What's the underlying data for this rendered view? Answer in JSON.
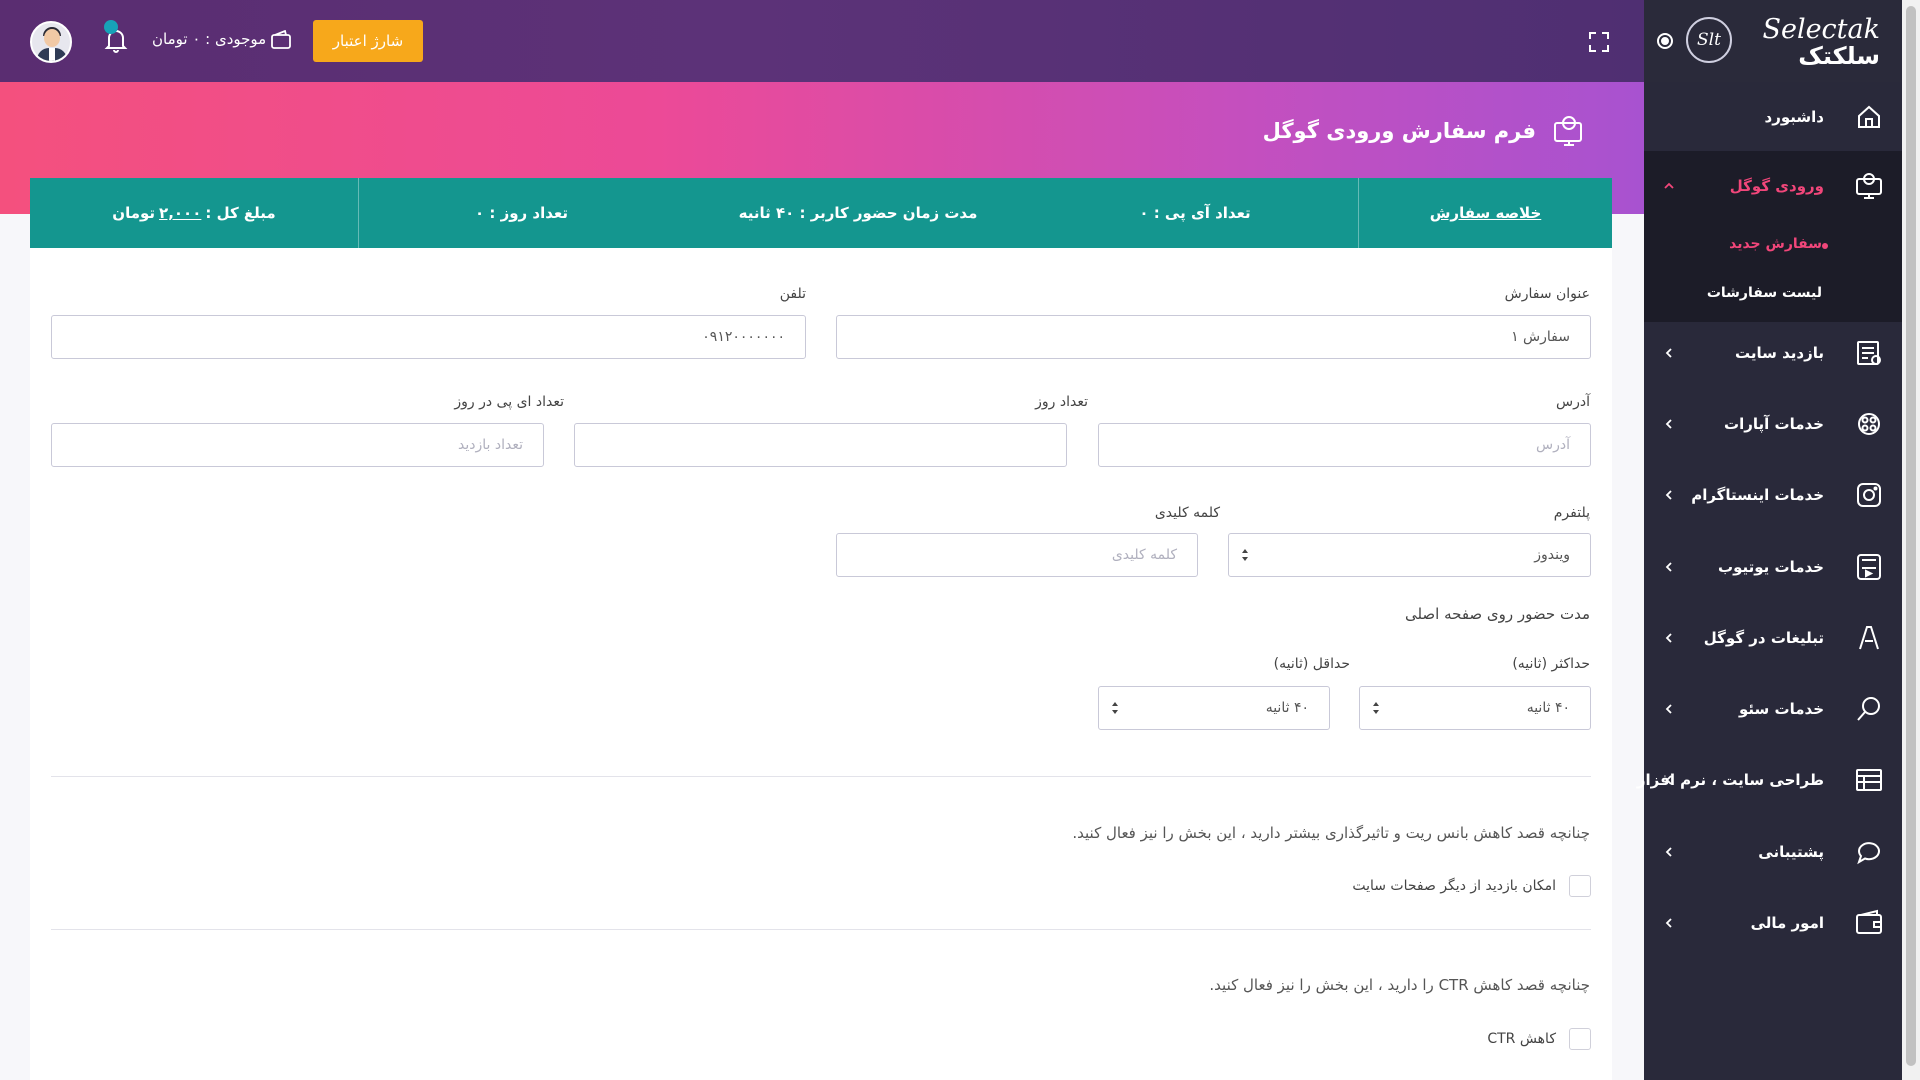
{
  "topbar": {
    "balance_text": "موجودی : ۰ تومان",
    "charge_button": "شارژ اعتبار"
  },
  "banner": {
    "title": "فرم سفارش ورودی گوگل"
  },
  "summary": {
    "order_summary_link": "خلاصه سفارش",
    "ip_count": "تعداد آی پی : ۰",
    "user_time": "مدت زمان حضور کاربر : ۴۰ ثانیه",
    "days_count": "تعداد روز : ۰",
    "total_label": "مبلغ کل :",
    "total_amount": "۲,۰۰۰",
    "total_unit": "تومان"
  },
  "form": {
    "order_title_label": "عنوان سفارش",
    "order_title_value": "سفارش ۱",
    "phone_label": "تلفن",
    "phone_value": "۰۹۱۲۰۰۰۰۰۰۰",
    "address_label": "آدرس",
    "address_placeholder": "آدرس",
    "days_label": "تعداد روز",
    "days_value": "",
    "ips_per_day_label": "تعداد ای پی در روز",
    "ips_per_day_placeholder": "تعداد بازدید",
    "platform_label": "پلتفرم",
    "platform_value": "ویندوز",
    "keyword_label": "کلمه کلیدی",
    "keyword_placeholder": "کلمه کلیدی",
    "presence_heading": "مدت حضور روی صفحه اصلی",
    "max_label": "حداکثر (ثانیه)",
    "max_value": "۴۰ ثانیه",
    "min_label": "حداقل (ثانیه)",
    "min_value": "۴۰ ثانیه",
    "bounce_note": "چنانچه قصد کاهش بانس ریت و تاثیرگذاری بیشتر دارید ، این بخش را نیز فعال کنید.",
    "bounce_checkbox_label": "امکان بازدید از دیگر صفحات سایت",
    "ctr_note": "چنانچه قصد کاهش CTR را دارید ، این بخش را نیز فعال کنید.",
    "ctr_checkbox_label": "کاهش CTR"
  },
  "sidebar": {
    "logo_text": "Selectak",
    "logo_sub": "سلکتک",
    "logo_badge": "Slt",
    "items": [
      {
        "label": "داشبورد",
        "icon": "home-icon"
      },
      {
        "label": "ورودی گوگل",
        "icon": "google-entry-icon"
      },
      {
        "label": "بازدید سایت",
        "icon": "site-visit-icon"
      },
      {
        "label": "خدمات آپارات",
        "icon": "aparat-icon"
      },
      {
        "label": "خدمات اینستاگرام",
        "icon": "instagram-icon"
      },
      {
        "label": "خدمات یوتیوب",
        "icon": "youtube-icon"
      },
      {
        "label": "تبلیغات در گوگل",
        "icon": "google-ads-icon"
      },
      {
        "label": "خدمات سئو",
        "icon": "search-icon"
      },
      {
        "label": "طراحی سایت ، نرم افزار",
        "icon": "web-design-icon"
      },
      {
        "label": "پشتیبانی",
        "icon": "chat-icon"
      },
      {
        "label": "امور مالی",
        "icon": "wallet-icon"
      }
    ],
    "subitems": [
      {
        "label": "سفارش جدید"
      },
      {
        "label": "لیست سفارشات"
      }
    ]
  }
}
